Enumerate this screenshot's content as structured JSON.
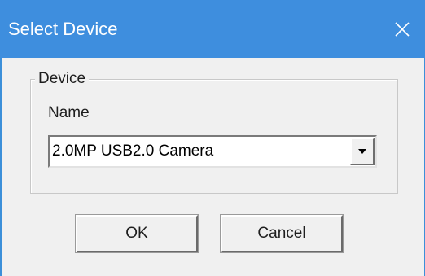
{
  "window": {
    "title": "Select Device",
    "title_bar_color": "#3e8ede",
    "close_icon": "close-icon"
  },
  "device_group": {
    "legend": "Device",
    "name_label": "Name",
    "device_select": {
      "selected_value": "2.0MP USB2.0 Camera",
      "arrow_icon": "dropdown-arrow-icon"
    }
  },
  "buttons": {
    "ok_label": "OK",
    "cancel_label": "Cancel"
  }
}
